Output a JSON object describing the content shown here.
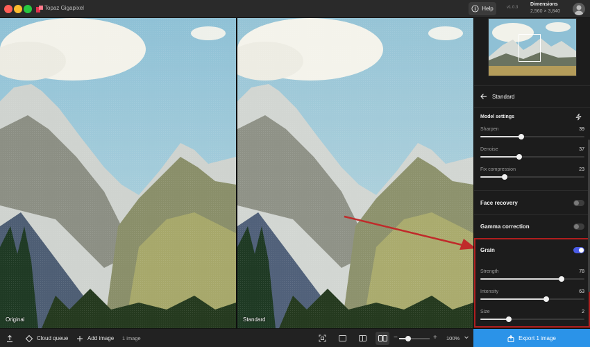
{
  "window": {
    "app_title": "Topaz Gigapixel",
    "help_label": "Help",
    "version": "v1.0.3",
    "dimensions_label": "Dimensions",
    "dimensions_value": "2,560 × 3,840"
  },
  "preview": {
    "left_label": "Original",
    "right_label": "Standard"
  },
  "panel": {
    "model_name": "Standard",
    "model_settings_title": "Model settings",
    "sliders": [
      {
        "label": "Sharpen",
        "value": "39",
        "level": 0.39
      },
      {
        "label": "Denoise",
        "value": "37",
        "level": 0.37
      },
      {
        "label": "Fix compression",
        "value": "23",
        "level": 0.23
      }
    ],
    "face_recovery": {
      "label": "Face recovery",
      "on": false
    },
    "gamma_correction": {
      "label": "Gamma correction",
      "on": false
    },
    "grain": {
      "label": "Grain",
      "on": true,
      "sliders": [
        {
          "label": "Strength",
          "value": "78",
          "level": 0.78
        },
        {
          "label": "Intensity",
          "value": "63",
          "level": 0.63
        },
        {
          "label": "Size",
          "value": "2",
          "level": 0.27
        }
      ]
    }
  },
  "bottombar": {
    "cloud_queue": "Cloud queue",
    "add_image": "Add image",
    "image_count": "1 image",
    "zoom": "100%",
    "zoom_level": 0.2,
    "export_label": "Export 1 image"
  },
  "colors": {
    "accent": "#2b93e8",
    "toggle_on": "#4b5ce6",
    "highlight": "#b01e1e"
  }
}
